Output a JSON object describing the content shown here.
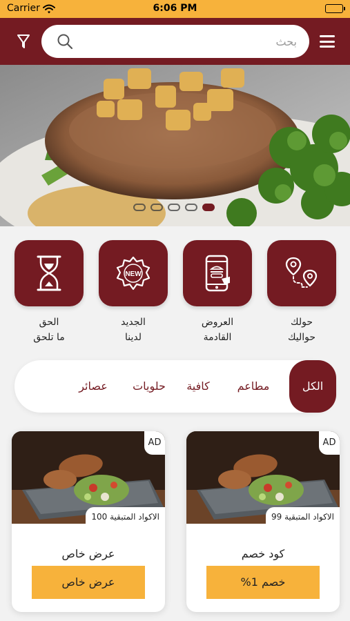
{
  "status_bar": {
    "carrier": "Carrier",
    "time": "6:06 PM"
  },
  "app_bar": {
    "search_placeholder": "بحث",
    "icons": {
      "filter": "filter-icon",
      "search": "search-icon",
      "menu": "hamburger-menu-icon"
    }
  },
  "banner": {
    "slide_count": 5,
    "active_slide": 5
  },
  "features": [
    {
      "icon": "hourglass-icon",
      "line1": "الحق",
      "line2": "ما تلحق"
    },
    {
      "icon": "new-badge-icon",
      "line1": "الجديد",
      "line2": "لدينا"
    },
    {
      "icon": "mobile-offers-icon",
      "line1": "العروض",
      "line2": "القادمة"
    },
    {
      "icon": "route-pins-icon",
      "line1": "حولك",
      "line2": "حواليك"
    }
  ],
  "categories": [
    {
      "label": "الكل",
      "active": true
    },
    {
      "label": "مطاعم",
      "active": false
    },
    {
      "label": "كافية",
      "active": false
    },
    {
      "label": "حلويات",
      "active": false
    },
    {
      "label": "عصائر",
      "active": false
    }
  ],
  "cards": [
    {
      "ad": "AD",
      "codes": "الاكواد المتبقية 99",
      "title": "كود خصم",
      "button": "خصم 1%"
    },
    {
      "ad": "AD",
      "codes": "الاكواد المتبقية 100",
      "title": "عرض خاص",
      "button": "عرض خاص"
    }
  ],
  "colors": {
    "primary": "#741b22",
    "accent": "#f7b23b",
    "background": "#f2f2f2"
  }
}
